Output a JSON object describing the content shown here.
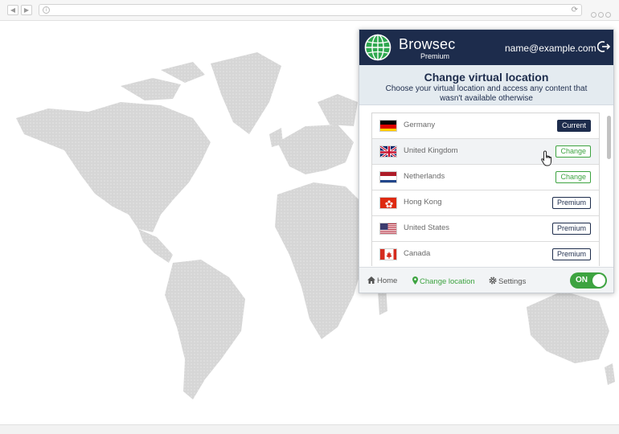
{
  "popup": {
    "brand": "Browsec",
    "plan": "Premium",
    "email": "name@example.com",
    "title": "Change virtual location",
    "subtitle": "Choose your virtual location and access any content that wasn't available otherwise",
    "countries": [
      {
        "name": "Germany",
        "badge": "Current",
        "badge_type": "current",
        "flag": "de"
      },
      {
        "name": "United Kingdom",
        "badge": "Change",
        "badge_type": "change",
        "flag": "gb"
      },
      {
        "name": "Netherlands",
        "badge": "Change",
        "badge_type": "change",
        "flag": "nl"
      },
      {
        "name": "Hong Kong",
        "badge": "Premium",
        "badge_type": "premium",
        "flag": "hk"
      },
      {
        "name": "United States",
        "badge": "Premium",
        "badge_type": "premium",
        "flag": "us"
      },
      {
        "name": "Canada",
        "badge": "Premium",
        "badge_type": "premium",
        "flag": "ca"
      }
    ],
    "footer": {
      "home": "Home",
      "change_location": "Change location",
      "settings": "Settings",
      "toggle": "ON"
    }
  },
  "colors": {
    "navy": "#1d2c4c",
    "green": "#3da340",
    "map": "#d9d9d9"
  }
}
